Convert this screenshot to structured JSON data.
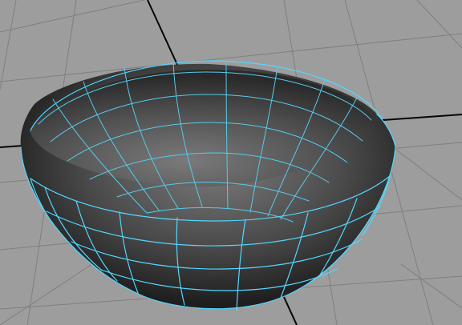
{
  "viewport": {
    "background_color": "#9d9d9d",
    "grid_color": "#7f7f7f",
    "axis_color": "#050505",
    "selection_wire_color": "#52d7ff"
  },
  "object": {
    "type": "hemisphere-bowl",
    "selected": true,
    "shader_dark": "#1f1f1f",
    "shader_mid": "#5c5c5c",
    "shader_light": "#828282"
  }
}
